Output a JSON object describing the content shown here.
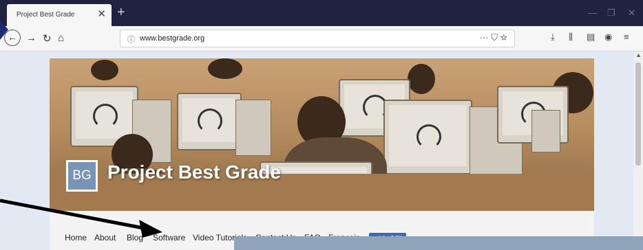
{
  "browser": {
    "tab_title": "Project Best Grade",
    "tab_close": "✕",
    "new_tab": "+",
    "url": "www.bestgrade.org",
    "url_dots": "···"
  },
  "site": {
    "logo_text": "BG",
    "title": "Project Best Grade",
    "menu": [
      "Home",
      "About",
      "Blog",
      "Software",
      "Video Tutorials",
      "Contact Us",
      "FAQ",
      "Francais"
    ],
    "like_label": "✓ Like 2.2K"
  },
  "colors": {
    "titlebar": "#202340",
    "logo": "#7894b7",
    "like": "#4267b2"
  }
}
